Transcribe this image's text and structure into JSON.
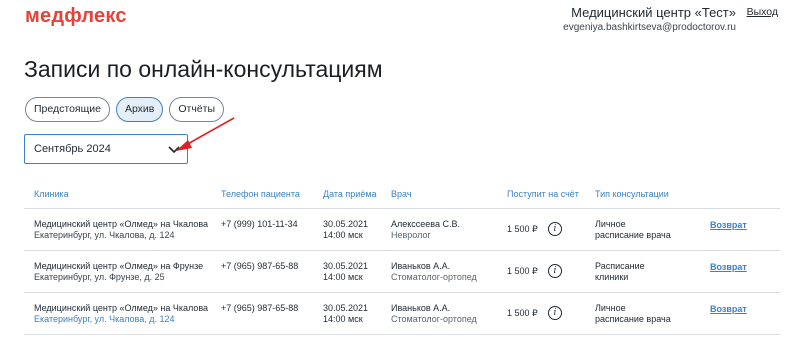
{
  "header": {
    "logo": "медфлекс",
    "org_name": "Медицинский центр «Тест»",
    "org_email": "evgeniya.bashkirtseva@prodoctorov.ru",
    "logout": "Выход"
  },
  "page": {
    "title": "Записи по онлайн-консультациям"
  },
  "tabs": [
    {
      "label": "Предстоящие",
      "active": false
    },
    {
      "label": "Архив",
      "active": true
    },
    {
      "label": "Отчёты",
      "active": false
    }
  ],
  "month_select": {
    "value": "Сентябрь 2024",
    "icon": "chevron-down-icon"
  },
  "table": {
    "columns": [
      "Клиника",
      "Телефон пациента",
      "Дата приёма",
      "Врач",
      "Поступит на счёт",
      "Тип консультации"
    ],
    "rows": [
      {
        "clinic_name": "Медицинский центр «Олмед» на Чкалова",
        "clinic_address": "Екатеринбург, ул. Чкалова, д. 124",
        "phone": "+7 (999) 101-11-34",
        "date": "30.05.2021",
        "time": "14:00 мск",
        "doctor_name": "Алекссеева С.В.",
        "doctor_spec": "Невролог",
        "amount": "1 500 ₽",
        "type_line1": "Личное",
        "type_line2": "расписание врача",
        "action": "Возврат"
      },
      {
        "clinic_name": "Медицинский центр «Олмед» на Фрунзе",
        "clinic_address": "Екатеринбург, ул. Фрунзе, д. 25",
        "phone": "+7 (965) 987-65-88",
        "date": "30.05.2021",
        "time": "14:00 мск",
        "doctor_name": "Иваньков А.А.",
        "doctor_spec": "Стоматолог-ортопед",
        "amount": "1 500 ₽",
        "type_line1": "Расписание",
        "type_line2": "клиники",
        "action": "Возврат"
      },
      {
        "clinic_name": "Медицинский центр «Олмед» на Чкалова",
        "clinic_address": "Екатеринбург, ул. Чкалова, д. 124",
        "phone": "+7 (965) 987-65-88",
        "date": "30.05.2021",
        "time": "14:00 мск",
        "doctor_name": "Иваньков А.А.",
        "doctor_spec": "Стоматолог-ортопед",
        "amount": "1 500 ₽",
        "type_line1": "Личное",
        "type_line2": "расписание врача",
        "action": "Возврат"
      }
    ]
  },
  "colors": {
    "brand": "#e8413a",
    "accent": "#3b82c4",
    "annotation_arrow": "#e02020"
  }
}
